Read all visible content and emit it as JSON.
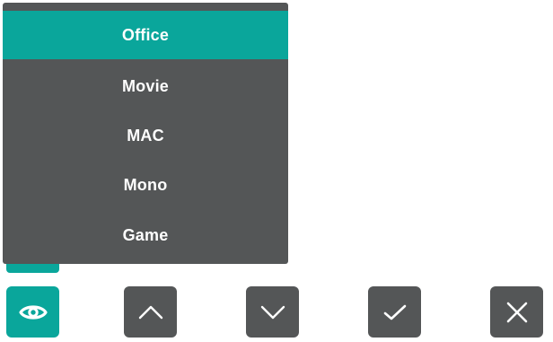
{
  "menu": {
    "items": [
      {
        "label": "Office",
        "selected": true
      },
      {
        "label": "Movie",
        "selected": false
      },
      {
        "label": "MAC",
        "selected": false
      },
      {
        "label": "Mono",
        "selected": false
      },
      {
        "label": "Game",
        "selected": false
      }
    ]
  },
  "buttons": [
    {
      "icon": "eye-icon",
      "color": "#0aa69b"
    },
    {
      "icon": "chevron-up-icon",
      "color": "#545657"
    },
    {
      "icon": "chevron-down-icon",
      "color": "#545657"
    },
    {
      "icon": "check-icon",
      "color": "#545657"
    },
    {
      "icon": "close-icon",
      "color": "#545657"
    }
  ],
  "colors": {
    "accent": "#0aa69b",
    "panel": "#545657",
    "text": "#ffffff"
  }
}
